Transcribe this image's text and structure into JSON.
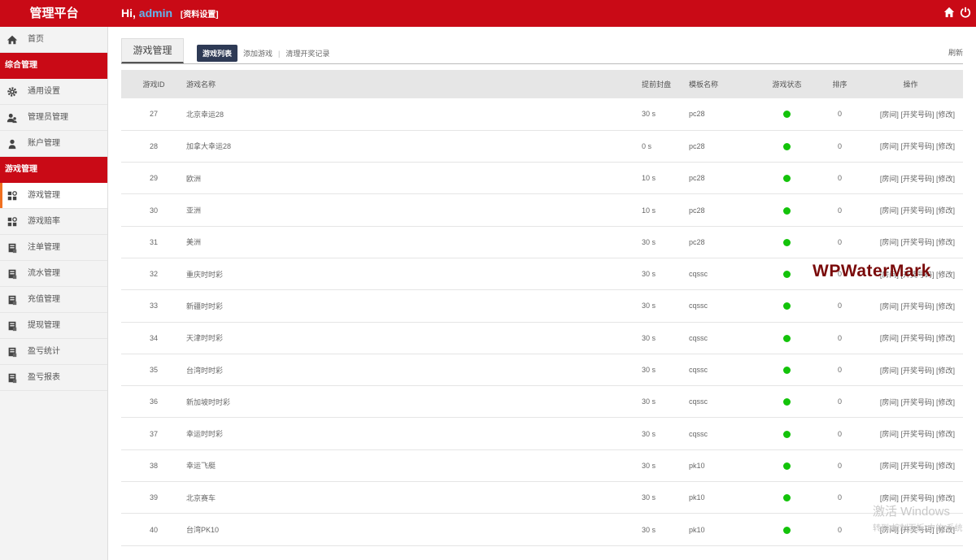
{
  "header": {
    "brand": "管理平台",
    "greeting": "Hi,",
    "username": "admin",
    "profile_link": "[资料设置]"
  },
  "sidebar": {
    "home": "首页",
    "group1": "综合管理",
    "items1": [
      "通用设置",
      "管理员管理",
      "账户管理"
    ],
    "group2": "游戏管理",
    "items2": [
      "游戏管理",
      "游戏赔率",
      "注单管理",
      "流水管理",
      "充值管理",
      "提现管理",
      "盈亏统计",
      "盈亏报表"
    ]
  },
  "main": {
    "page_tab": "游戏管理",
    "subnav": {
      "active": "游戏列表",
      "add": "添加游戏",
      "clean": "清理开奖记录"
    },
    "refresh": "刷新",
    "columns": [
      "游戏ID",
      "游戏名称",
      "提前封盘",
      "模板名称",
      "游戏状态",
      "排序",
      "操作"
    ],
    "rows": [
      {
        "id": "27",
        "name": "北京幸运28",
        "close": "30 s",
        "tpl": "pc28",
        "sort": "0"
      },
      {
        "id": "28",
        "name": "加拿大幸运28",
        "close": "0 s",
        "tpl": "pc28",
        "sort": "0"
      },
      {
        "id": "29",
        "name": "欧洲",
        "close": "10 s",
        "tpl": "pc28",
        "sort": "0"
      },
      {
        "id": "30",
        "name": "亚洲",
        "close": "10 s",
        "tpl": "pc28",
        "sort": "0"
      },
      {
        "id": "31",
        "name": "美洲",
        "close": "30 s",
        "tpl": "pc28",
        "sort": "0"
      },
      {
        "id": "32",
        "name": "重庆时时彩",
        "close": "30 s",
        "tpl": "cqssc",
        "sort": "0"
      },
      {
        "id": "33",
        "name": "新疆时时彩",
        "close": "30 s",
        "tpl": "cqssc",
        "sort": "0"
      },
      {
        "id": "34",
        "name": "天津时时彩",
        "close": "30 s",
        "tpl": "cqssc",
        "sort": "0"
      },
      {
        "id": "35",
        "name": "台湾时时彩",
        "close": "30 s",
        "tpl": "cqssc",
        "sort": "0"
      },
      {
        "id": "36",
        "name": "新加坡时时彩",
        "close": "30 s",
        "tpl": "cqssc",
        "sort": "0"
      },
      {
        "id": "37",
        "name": "幸运时时彩",
        "close": "30 s",
        "tpl": "cqssc",
        "sort": "0"
      },
      {
        "id": "38",
        "name": "幸运飞艇",
        "close": "30 s",
        "tpl": "pk10",
        "sort": "0"
      },
      {
        "id": "39",
        "name": "北京赛车",
        "close": "30 s",
        "tpl": "pk10",
        "sort": "0"
      },
      {
        "id": "40",
        "name": "台湾PK10",
        "close": "30 s",
        "tpl": "pk10",
        "sort": "0"
      }
    ],
    "ops": {
      "room": "[房间]",
      "draw": "[开奖号码]",
      "edit": "[修改]"
    }
  },
  "overlay": {
    "watermark": "WPWaterMark",
    "activation": "激活 Windows",
    "activation_hint": "转到\"控制面板\"中的\"系统"
  },
  "colors": {
    "header": "#c90a16",
    "status_on": "#13c30a",
    "sidebar_accent": "#f07020"
  }
}
